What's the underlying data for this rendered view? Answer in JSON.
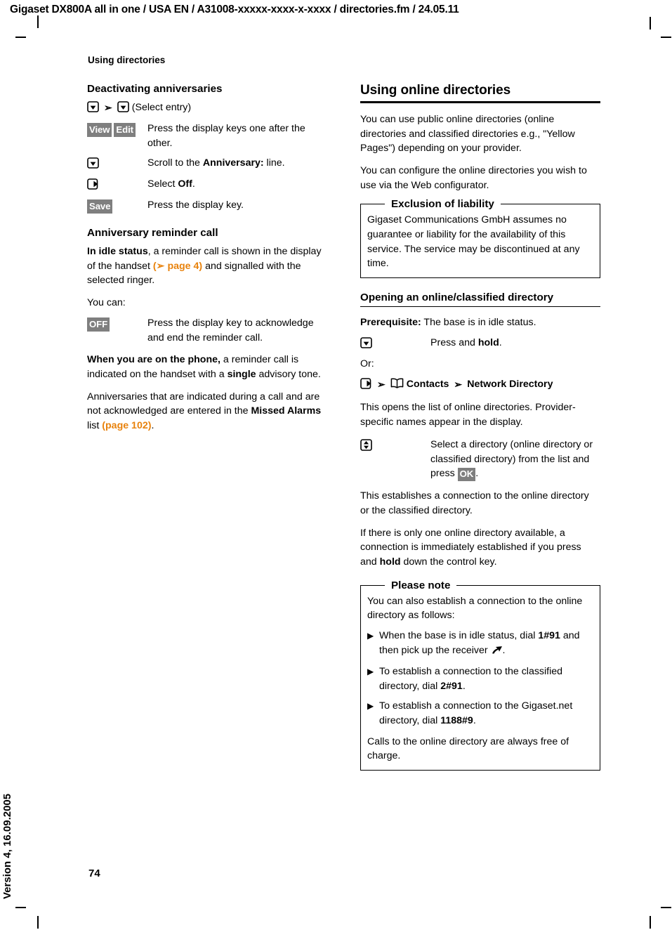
{
  "document": {
    "running_head": "Gigaset DX800A all in one / USA EN / A31008-xxxxx-xxxx-x-xxxx / directories.fm / 24.05.11",
    "chapter_title": "Using directories",
    "version_note": "Version 4, 16.09.2005",
    "page_number": "74",
    "accent_color": "#E8820C",
    "softkey_color": "#7F7F7F"
  },
  "left_column": {
    "heading_deactivating": "Deactivating anniversaries",
    "select_entry_label": "(Select entry)",
    "steps_deactivating": [
      {
        "keys": [
          "View",
          "Edit"
        ],
        "key_type": "softkey",
        "text_plain": "Press the display keys one after the other."
      },
      {
        "keys": [
          "control-key-down-icon"
        ],
        "key_type": "icon",
        "text_prefix": "Scroll to the ",
        "text_bold": "Anniversary:",
        "text_suffix": " line."
      },
      {
        "keys": [
          "control-key-right-icon"
        ],
        "key_type": "icon",
        "text_prefix": "Select ",
        "text_bold": "Off",
        "text_suffix": "."
      },
      {
        "keys": [
          "Save"
        ],
        "key_type": "softkey",
        "text_plain": "Press the display key."
      }
    ],
    "heading_reminder": "Anniversary reminder call",
    "para_idle_bold": "In idle status",
    "para_idle_1": ", a reminder call is shown in the display of the handset ",
    "para_idle_xref_open": "(",
    "para_idle_xref": "page 4)",
    "para_idle_2": " and signalled with the selected ringer.",
    "you_can": "You can:",
    "step_off_key": "OFF",
    "step_off_text": "Press the display key to acknowledge and end the reminder call.",
    "para_phone_bold": "When you are on the phone,",
    "para_phone_1": " a reminder call is indicated on the handset with a ",
    "para_phone_bold2": "single",
    "para_phone_2": " advisory tone.",
    "para_missed_1": "Anniversaries that are indicated during a call and are not acknowledged are entered in the ",
    "para_missed_bold": "Missed Alarms",
    "para_missed_2": " list ",
    "para_missed_xref": "(page 102)",
    "para_missed_3": "."
  },
  "right_column": {
    "heading_online": "Using online directories",
    "para_public": "You can use public online directories (online directories and classified directories e.g., \"Yellow Pages\") depending on your provider.",
    "para_configure": "You can configure the online directories you wish to use via the Web configurator.",
    "exclusion_box": {
      "title": "Exclusion of liability",
      "body": "Gigaset Communications GmbH assumes no guarantee or liability for the availability of this service. The service may be discontinued at any time."
    },
    "heading_opening": "Opening an online/classified directory",
    "prerequisite_bold": "Prerequisite:",
    "prerequisite_text": " The base is in idle status.",
    "step_press_hold_prefix": "Press and ",
    "step_press_hold_bold": "hold",
    "step_press_hold_suffix": ".",
    "or_label": "Or:",
    "nav_contacts": "Contacts",
    "nav_network_directory": "Network Directory",
    "para_opens_list": "This opens the list of online directories. Provider-specific names appear in the display.",
    "step_select_1": "Select a directory (online directory or classified directory) from the list and press ",
    "step_select_key": "OK",
    "step_select_2": ".",
    "para_establishes": "This establishes a connection to the online directory or the classified directory.",
    "para_only_one_1": "If there is only one online directory available, a connection is immediately established if you press and ",
    "para_only_one_bold": "hold",
    "para_only_one_2": " down the control key.",
    "note_box": {
      "title": "Please note",
      "intro": "You can also establish a connection to the online directory as follows:",
      "bullets": [
        {
          "text_1": "When the base is in idle status, dial ",
          "bold": "1#91",
          "text_2": " and then pick up the receiver ",
          "icon": "receiver-icon",
          "text_3": "."
        },
        {
          "text_1": "To establish a connection to the classified directory, dial ",
          "bold": "2#91",
          "text_2": ".",
          "icon": "",
          "text_3": ""
        },
        {
          "text_1": "To establish a connection to the Gigaset.net directory, dial ",
          "bold": "1188#9",
          "text_2": ".",
          "icon": "",
          "text_3": ""
        }
      ],
      "footer": "Calls to the online directory are always free of charge."
    }
  }
}
